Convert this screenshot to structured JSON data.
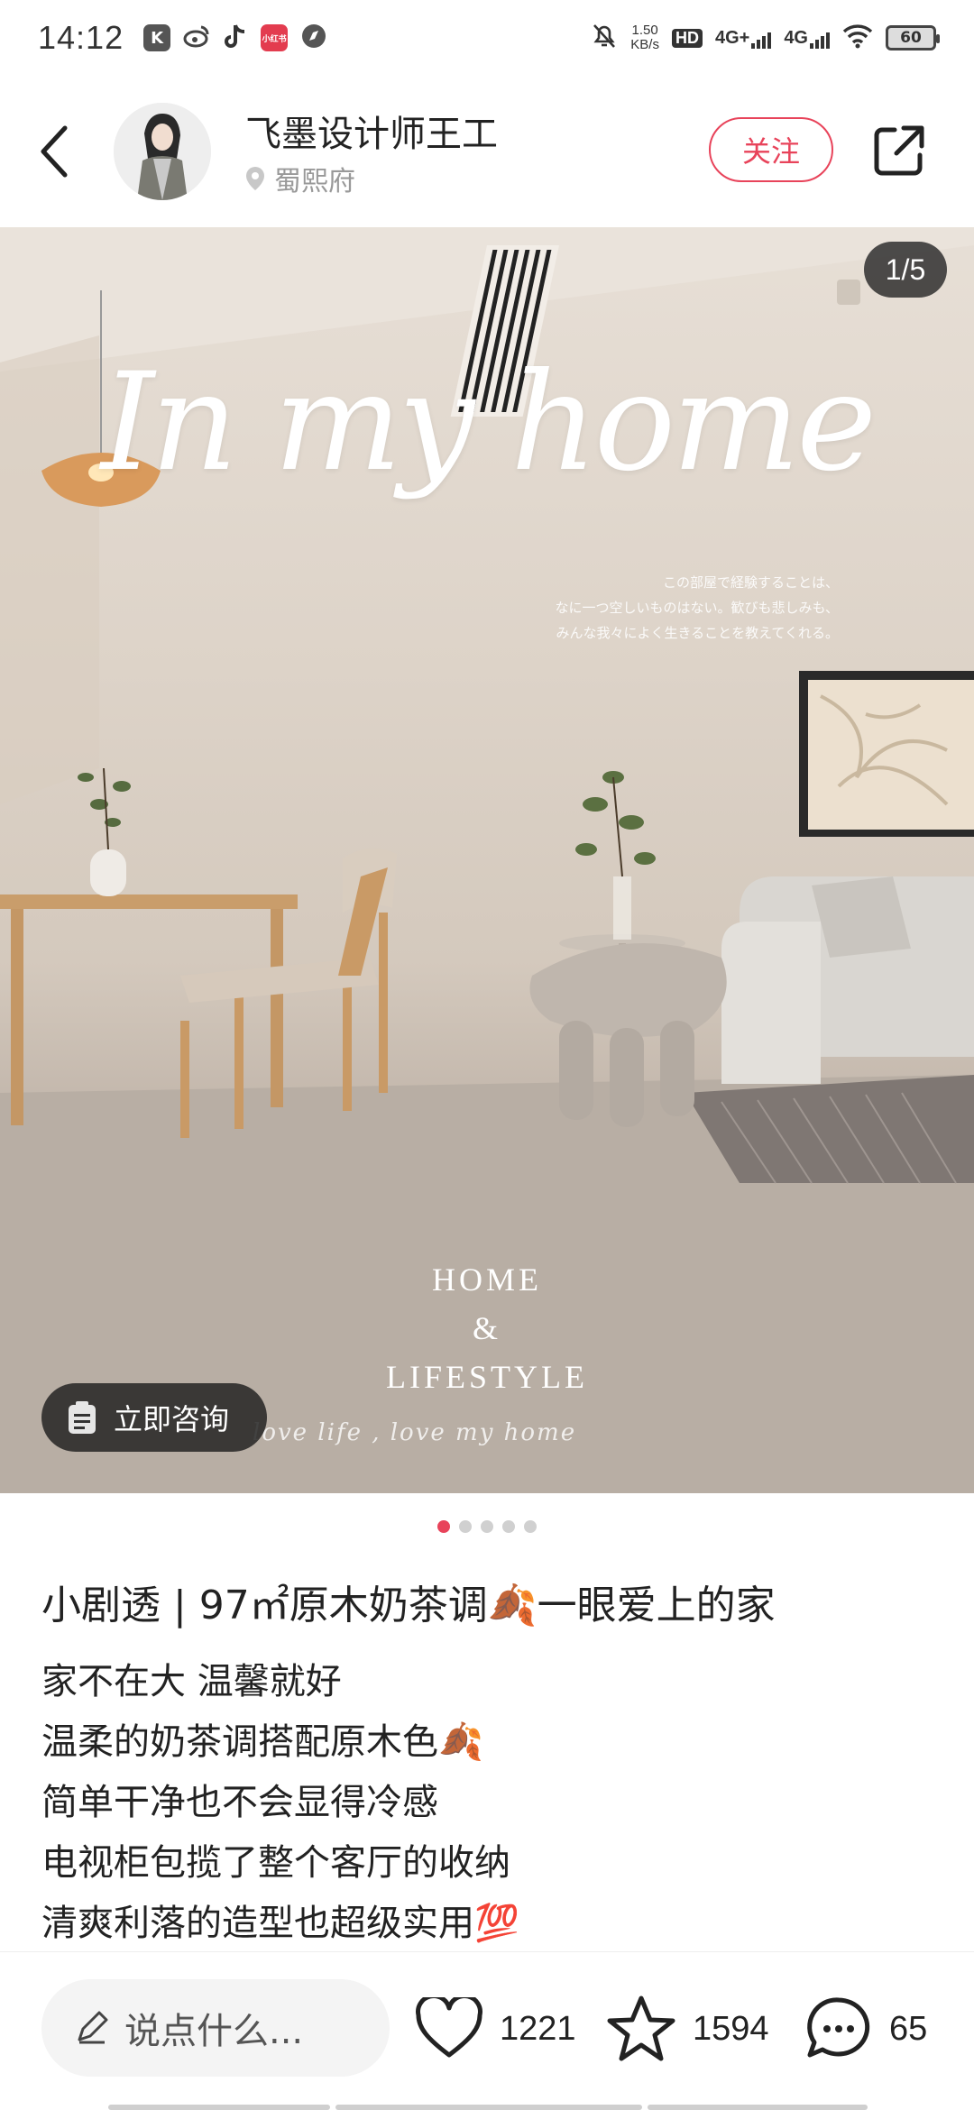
{
  "status_bar": {
    "time": "14:12",
    "speed_value": "1.50",
    "speed_unit": "KB/s",
    "hd": "HD",
    "network_1": "4G+",
    "network_2": "4G",
    "battery": "60"
  },
  "header": {
    "author": "飞墨设计师王工",
    "location": "蜀熙府",
    "follow_label": "关注"
  },
  "image": {
    "counter": "1/5",
    "consult_label": "立即咨询",
    "script_title": "In my home",
    "japanese_lines": [
      "この部屋で経験することは、",
      "なに一つ空しいものはない。歓びも悲しみも、",
      "みんな我々によく生きることを教えてくれる。"
    ],
    "home_line": "HOME",
    "amp_line": "&",
    "lifestyle_line": "LIFESTYLE",
    "love_line": "love life , love my home"
  },
  "post": {
    "title": "小剧透 | 97㎡原木奶茶调🍂一眼爱上的家",
    "body": [
      "家不在大 温馨就好",
      "温柔的奶茶调搭配原木色🍂",
      "简单干净也不会显得冷感",
      "电视柜包揽了整个客厅的收纳",
      "清爽利落的造型也超级实用💯"
    ]
  },
  "bottom_bar": {
    "comment_placeholder": "说点什么...",
    "likes": "1221",
    "collects": "1594",
    "comments": "65"
  },
  "colors": {
    "accent": "#e8435a",
    "text": "#222222"
  }
}
